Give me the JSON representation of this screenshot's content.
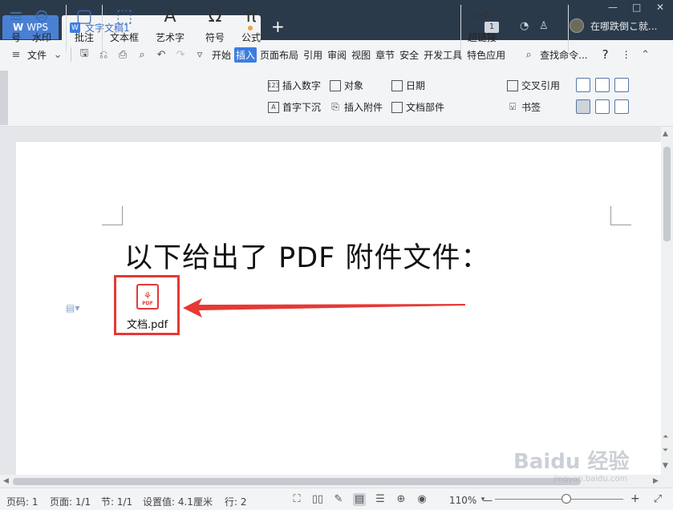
{
  "titlebar": {
    "wps_label": "WPS",
    "doc_tab_title": "文字文稿1",
    "new_tab_symbol": "+",
    "page_count_badge": "1",
    "user_name": "在哪跌倒こ就...",
    "window_controls": [
      "—",
      "□",
      "✕"
    ]
  },
  "menubar": {
    "file_label": "文件",
    "tabs": [
      "开始",
      "插入",
      "页面布局",
      "引用",
      "审阅",
      "视图",
      "章节",
      "安全",
      "开发工具",
      "特色应用"
    ],
    "active_tab": "插入",
    "search_label": "查找命令...",
    "help_symbol": "?",
    "more_symbol": "⋮"
  },
  "ribbon": {
    "watermark_label": "水印",
    "comment_label": "批注",
    "textbox_label": "文本框",
    "wordart_label": "艺术字",
    "symbol_label": "符号",
    "formula_label": "公式",
    "insert_number_label": "插入数字",
    "object_label": "对象",
    "date_label": "日期",
    "dropcap_label": "首字下沉",
    "insert_attachment_label": "插入附件",
    "doc_parts_label": "文档部件",
    "hyperlink_label": "超链接",
    "crossref_label": "交叉引用",
    "bookmark_label": "书签",
    "partial_label": "号"
  },
  "document": {
    "heading": "以下给出了 PDF 附件文件：",
    "attachment_name": "文档.pdf",
    "pdf_icon_text": "PDF"
  },
  "statusbar": {
    "page_num": "页码: 1",
    "pages": "页面: 1/1",
    "section": "节: 1/1",
    "setting": "设置值: 4.1厘米",
    "line": "行: 2",
    "zoom": "110%",
    "zoom_minus": "—",
    "zoom_plus": "+"
  },
  "watermark": {
    "main": "Baidu 经验",
    "sub": "jingyan.baidu.com"
  },
  "colors": {
    "titlebar_bg": "#2b3a4a",
    "accent": "#3b7de0",
    "highlight_red": "#e53935"
  }
}
